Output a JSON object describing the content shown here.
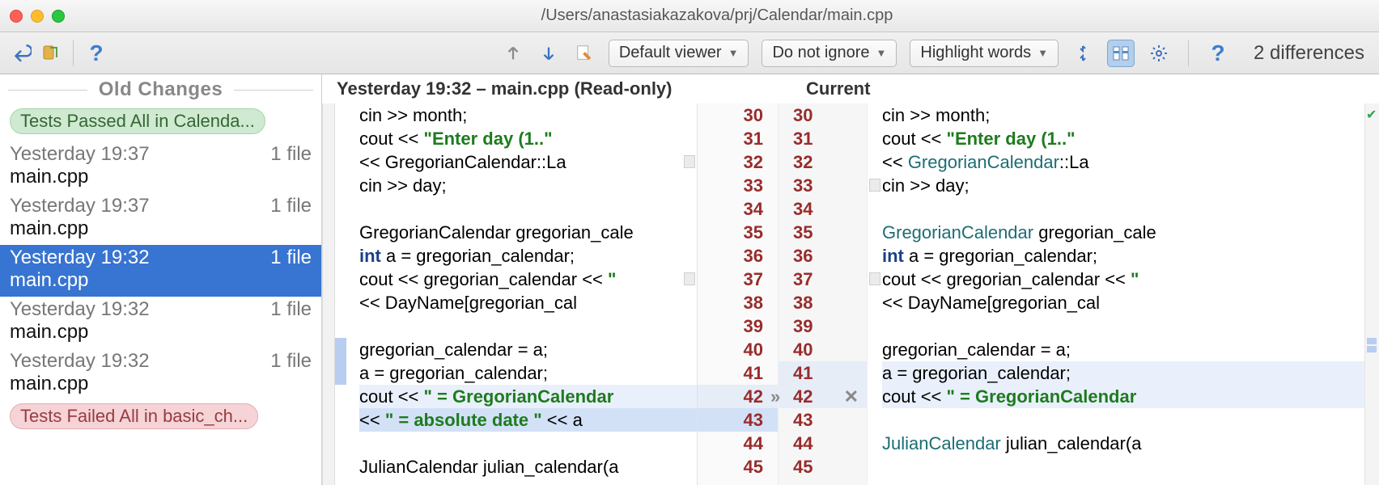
{
  "window": {
    "title": "/Users/anastasiakazakova/prj/Calendar/main.cpp"
  },
  "toolbar": {
    "viewer_dd": "Default viewer",
    "ignore_dd": "Do not ignore",
    "highlight_dd": "Highlight words",
    "diff_count": "2 differences"
  },
  "sidebar": {
    "header": "Old Changes",
    "badge_pass": "Tests Passed All in Calenda...",
    "badge_fail": "Tests Failed All in basic_ch...",
    "items": [
      {
        "time": "Yesterday 19:37",
        "info": "1 file",
        "file": "main.cpp",
        "selected": false
      },
      {
        "time": "Yesterday 19:37",
        "info": "1 file",
        "file": "main.cpp",
        "selected": false
      },
      {
        "time": "Yesterday 19:32",
        "info": "1 file",
        "file": "main.cpp",
        "selected": true
      },
      {
        "time": "Yesterday 19:32",
        "info": "1 file",
        "file": "main.cpp",
        "selected": false
      },
      {
        "time": "Yesterday 19:32",
        "info": "1 file",
        "file": "main.cpp",
        "selected": false
      }
    ]
  },
  "diff": {
    "left_title": "Yesterday 19:32 – main.cpp (Read-only)",
    "right_title": "Current",
    "lines": [
      {
        "ln": 30,
        "left": [
          {
            "t": "cin >> month;"
          }
        ],
        "right": [
          {
            "t": "cin >> month;"
          }
        ]
      },
      {
        "ln": 31,
        "left": [
          {
            "t": "cout << "
          },
          {
            "t": "\"Enter day (1..\"",
            "c": "str"
          }
        ],
        "right": [
          {
            "t": "cout << "
          },
          {
            "t": "\"Enter day (1..\"",
            "c": "str"
          }
        ]
      },
      {
        "ln": 32,
        "left": [
          {
            "t": "     << GregorianCalendar::La"
          }
        ],
        "right": [
          {
            "t": "         << "
          },
          {
            "t": "GregorianCalendar",
            "c": "type"
          },
          {
            "t": "::La"
          }
        ],
        "foldL": true
      },
      {
        "ln": 33,
        "left": [
          {
            "t": "cin >> day;"
          }
        ],
        "right": [
          {
            "t": "cin >> day;"
          }
        ],
        "foldR": true
      },
      {
        "ln": 34,
        "left": [
          {
            "t": ""
          }
        ],
        "right": [
          {
            "t": ""
          }
        ]
      },
      {
        "ln": 35,
        "left": [
          {
            "t": "GregorianCalendar gregorian_cale"
          }
        ],
        "right": [
          {
            "t": "GregorianCalendar",
            "c": "type"
          },
          {
            "t": " gregorian_cale"
          }
        ]
      },
      {
        "ln": 36,
        "left": [
          {
            "t": "int",
            "c": "kw"
          },
          {
            "t": " a = gregorian_calendar;"
          }
        ],
        "right": [
          {
            "t": "int",
            "c": "kw"
          },
          {
            "t": " a = gregorian_calendar;"
          }
        ]
      },
      {
        "ln": 37,
        "left": [
          {
            "t": "cout << gregorian_calendar << "
          },
          {
            "t": "\"",
            "c": "str"
          }
        ],
        "right": [
          {
            "t": "cout << gregorian_calendar << "
          },
          {
            "t": "\"",
            "c": "str"
          }
        ],
        "foldL": true,
        "foldR": true
      },
      {
        "ln": 38,
        "left": [
          {
            "t": "     << DayName[gregorian_cal"
          }
        ],
        "right": [
          {
            "t": "     << DayName[gregorian_cal"
          }
        ]
      },
      {
        "ln": 39,
        "left": [
          {
            "t": ""
          }
        ],
        "right": [
          {
            "t": ""
          }
        ]
      },
      {
        "ln": 40,
        "left": [
          {
            "t": "gregorian_calendar = a;"
          }
        ],
        "right": [
          {
            "t": "gregorian_calendar = a;"
          }
        ],
        "markerL": true
      },
      {
        "ln": 41,
        "left": [
          {
            "t": "a = gregorian_calendar;"
          }
        ],
        "right": [
          {
            "t": "a = gregorian_calendar;"
          }
        ],
        "markerL": true,
        "hlR": "hl-blue-light"
      },
      {
        "ln": 42,
        "left": [
          {
            "t": "cout << "
          },
          {
            "t": "\"   = GregorianCalendar",
            "c": "str"
          }
        ],
        "right": [
          {
            "t": " cout << "
          },
          {
            "t": "\"   = GregorianCalendar",
            "c": "str"
          }
        ],
        "hlL": "hl-blue-light",
        "hlR": "hl-blue-light",
        "actions": true
      },
      {
        "ln": 43,
        "left": [
          {
            "t": "    << "
          },
          {
            "t": "\" = absolute date \"",
            "c": "str"
          },
          {
            "t": " << a"
          }
        ],
        "right": [
          {
            "t": ""
          }
        ],
        "hlL": "hl-blue"
      },
      {
        "ln": 44,
        "left": [
          {
            "t": ""
          }
        ],
        "right": [
          {
            "t": "JulianCalendar",
            "c": "type"
          },
          {
            "t": " julian_calendar(a"
          }
        ]
      },
      {
        "ln": 45,
        "left": [
          {
            "t": "JulianCalendar julian_calendar(a"
          }
        ],
        "right": [
          {
            "t": ""
          }
        ]
      }
    ]
  }
}
